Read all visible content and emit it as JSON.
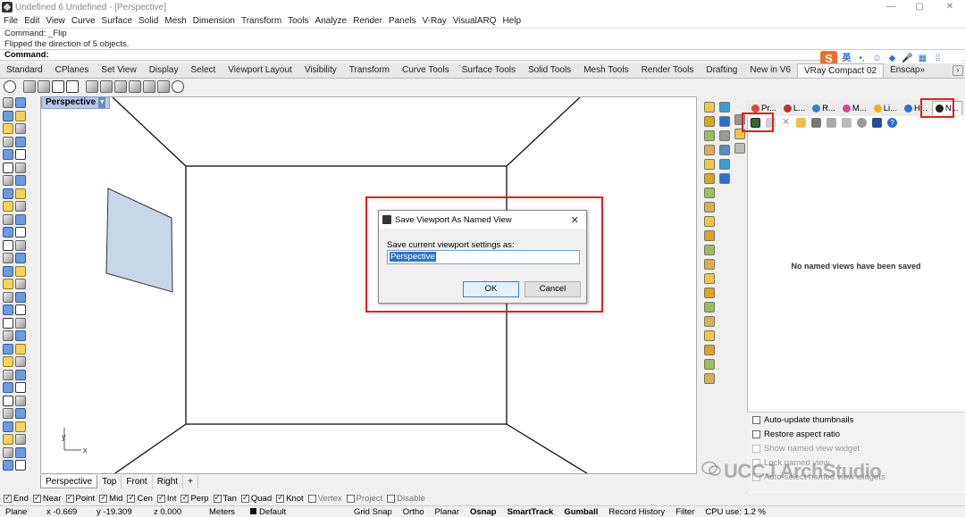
{
  "window": {
    "title": "Undefined 6 Undefined - [Perspective]",
    "controls": [
      "—",
      "▢",
      "✕"
    ]
  },
  "menu": [
    "File",
    "Edit",
    "View",
    "Curve",
    "Surface",
    "Solid",
    "Mesh",
    "Dimension",
    "Transform",
    "Tools",
    "Analyze",
    "Render",
    "Panels",
    "V-Ray",
    "VisualARQ",
    "Help"
  ],
  "command": {
    "history": [
      "Command: _Flip",
      "Flipped the direction of 5 objects."
    ],
    "prompt": "Command:"
  },
  "ime": {
    "logo": "S",
    "lang": "英"
  },
  "tabs": [
    "Standard",
    "CPlanes",
    "Set View",
    "Display",
    "Select",
    "Viewport Layout",
    "Visibility",
    "Transform",
    "Curve Tools",
    "Surface Tools",
    "Solid Tools",
    "Mesh Tools",
    "Render Tools",
    "Drafting",
    "New in V6",
    "VRay Compact 02",
    "Enscap»"
  ],
  "active_tab": "VRay Compact 02",
  "viewport": {
    "title": "Perspective",
    "axis_y": "y",
    "axis_x": "x",
    "tabs": [
      "Perspective",
      "Top",
      "Front",
      "Right",
      "+"
    ],
    "active_tab": "Perspective"
  },
  "panel": {
    "tabs": [
      {
        "label": "Pr...",
        "color": "#e04040"
      },
      {
        "label": "L...",
        "color": "#c03030"
      },
      {
        "label": "R...",
        "color": "#3a7bd5"
      },
      {
        "label": "M...",
        "color": "#d04a90"
      },
      {
        "label": "Li...",
        "color": "#f0b020"
      },
      {
        "label": "H...",
        "color": "#2a6fd6"
      },
      {
        "label": "N...",
        "color": "#222222"
      }
    ],
    "empty_message": "No named views have been saved",
    "options": [
      {
        "label": "Auto-update thumbnails",
        "checked": false,
        "enabled": true
      },
      {
        "label": "Restore aspect ratio",
        "checked": false,
        "enabled": true
      },
      {
        "label": "Show named view widget",
        "checked": false,
        "enabled": false
      },
      {
        "label": "Lock named view",
        "checked": false,
        "enabled": false
      },
      {
        "label": "Auto-select named view widgets",
        "checked": false,
        "enabled": false
      }
    ]
  },
  "dialog": {
    "title": "Save Viewport As Named View",
    "label": "Save current viewport settings as:",
    "value": "Perspective",
    "ok": "OK",
    "cancel": "Cancel"
  },
  "osnap": [
    {
      "label": "End",
      "checked": true
    },
    {
      "label": "Near",
      "checked": true
    },
    {
      "label": "Point",
      "checked": true
    },
    {
      "label": "Mid",
      "checked": true
    },
    {
      "label": "Cen",
      "checked": true
    },
    {
      "label": "Int",
      "checked": true
    },
    {
      "label": "Perp",
      "checked": true
    },
    {
      "label": "Tan",
      "checked": true
    },
    {
      "label": "Quad",
      "checked": true
    },
    {
      "label": "Knot",
      "checked": true
    },
    {
      "label": "Vertex",
      "checked": false
    },
    {
      "label": "Project",
      "checked": false
    },
    {
      "label": "Disable",
      "checked": false
    }
  ],
  "status": {
    "cplane": "Plane",
    "x": "x -0.669",
    "y": "y -19.309",
    "z": "z 0.000",
    "units": "Meters",
    "layer": "Default",
    "grid_snap": "Grid Snap",
    "ortho": "Ortho",
    "planar": "Planar",
    "osnap": "Osnap",
    "smarttrack": "SmartTrack",
    "gumball": "Gumball",
    "record_history": "Record History",
    "filter": "Filter",
    "cpu": "CPU use: 1.2 %"
  },
  "watermark": "UCCJ ArchStudio",
  "colors": {
    "highlight_red": "#e02020",
    "selection_blue": "#3271c8",
    "wall_plane": "#c8d6ea"
  }
}
